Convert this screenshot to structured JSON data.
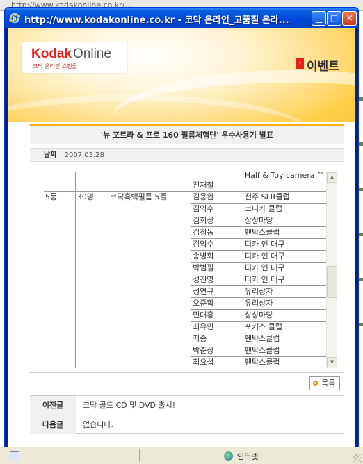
{
  "browser": {
    "url_partial": "http://www.kodakonline.co.kr/...",
    "window_title": "http://www.kodakonline.co.kr - 코닥 온라인_고품질 온라...",
    "status_zone": "인터넷"
  },
  "header": {
    "logo_brand": "Kodak",
    "logo_suffix": "Online",
    "logo_tagline": "코닥 온라인 쇼핑몰",
    "section_title": "이벤트"
  },
  "article": {
    "subject": "'뉴 포트라 & 프로 160 필름체험단' 우수사용기 발표",
    "date_label": "날짜",
    "date_value": "2007.03.28"
  },
  "winners": {
    "prev_row": {
      "name": "진재철",
      "club": "Half & Toy camera ™"
    },
    "group": {
      "rank": "5등",
      "count": "30명",
      "prize": "코닥흑백필름 5롤"
    },
    "rows": [
      {
        "name": "김용완",
        "club": "전주 SLR클럽"
      },
      {
        "name": "김익수",
        "club": "코니카 클럽"
      },
      {
        "name": "김희상",
        "club": "상상마당"
      },
      {
        "name": "김정동",
        "club": "펜탁스클럽"
      },
      {
        "name": "김익수",
        "club": "디카 인 대구"
      },
      {
        "name": "송병희",
        "club": "디카 인 대구"
      },
      {
        "name": "박범필",
        "club": "디카 인 대구"
      },
      {
        "name": "성진영",
        "club": "디카 인 대구"
      },
      {
        "name": "성연규",
        "club": "유리상자"
      },
      {
        "name": "오준학",
        "club": "유리상자"
      },
      {
        "name": "민대홍",
        "club": "상상마당"
      },
      {
        "name": "최유민",
        "club": "포커스 클럽"
      },
      {
        "name": "최송",
        "club": "펜탁스클럽"
      },
      {
        "name": "박준상",
        "club": "펜탁스클럽"
      },
      {
        "name": "최요섭",
        "club": "펜탁스클럽"
      }
    ]
  },
  "buttons": {
    "list": "목록"
  },
  "navigation": {
    "prev_label": "이전글",
    "prev_title": "코닥 골드 CD 및 DVD 출시!",
    "next_label": "다음글",
    "next_title": "없습니다."
  },
  "colors": {
    "kodak_red": "#e2231a",
    "accent_orange": "#f7b200",
    "titlebar_blue": "#0046d5"
  }
}
